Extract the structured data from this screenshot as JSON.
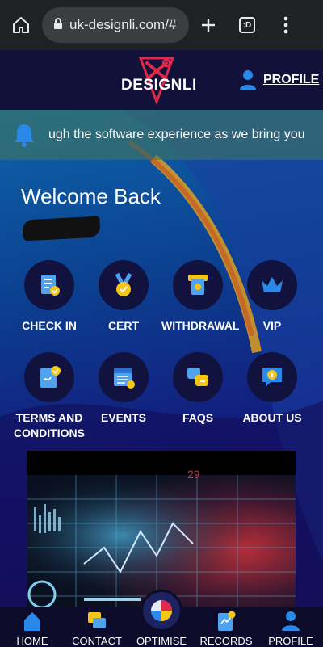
{
  "browser": {
    "url": "uk-designli.com/#",
    "tabs_count": ":D"
  },
  "header": {
    "logo_text": "DESIGNLI",
    "profile_label": "PROFILE"
  },
  "marquee": {
    "text": "ugh the software experience as we bring your a"
  },
  "welcome": {
    "title": "Welcome Back"
  },
  "tiles": [
    {
      "label": "CHECK IN",
      "icon": "check-in-icon"
    },
    {
      "label": "CERT",
      "icon": "medal-icon"
    },
    {
      "label": "WITHDRAWAL",
      "icon": "atm-icon"
    },
    {
      "label": "VIP",
      "icon": "crown-icon"
    },
    {
      "label": "TERMS AND CONDITIONS",
      "icon": "document-check-icon"
    },
    {
      "label": "EVENTS",
      "icon": "calendar-icon"
    },
    {
      "label": "FAQS",
      "icon": "qa-chat-icon"
    },
    {
      "label": "ABOUT US",
      "icon": "info-bubble-icon"
    }
  ],
  "promo": {
    "readout": "29"
  },
  "bottom_nav": [
    {
      "label": "HOME",
      "icon": "home-icon"
    },
    {
      "label": "CONTACT",
      "icon": "chat-icon"
    },
    {
      "label": "OPTIMISE",
      "icon": "pie-chart-icon"
    },
    {
      "label": "RECORDS",
      "icon": "records-icon"
    },
    {
      "label": "PROFILE",
      "icon": "user-icon"
    }
  ],
  "colors": {
    "accent_blue": "#2a88e8",
    "gold": "#f5c518",
    "header_bg": "#111139",
    "nav_bg": "#0c0c2a"
  }
}
